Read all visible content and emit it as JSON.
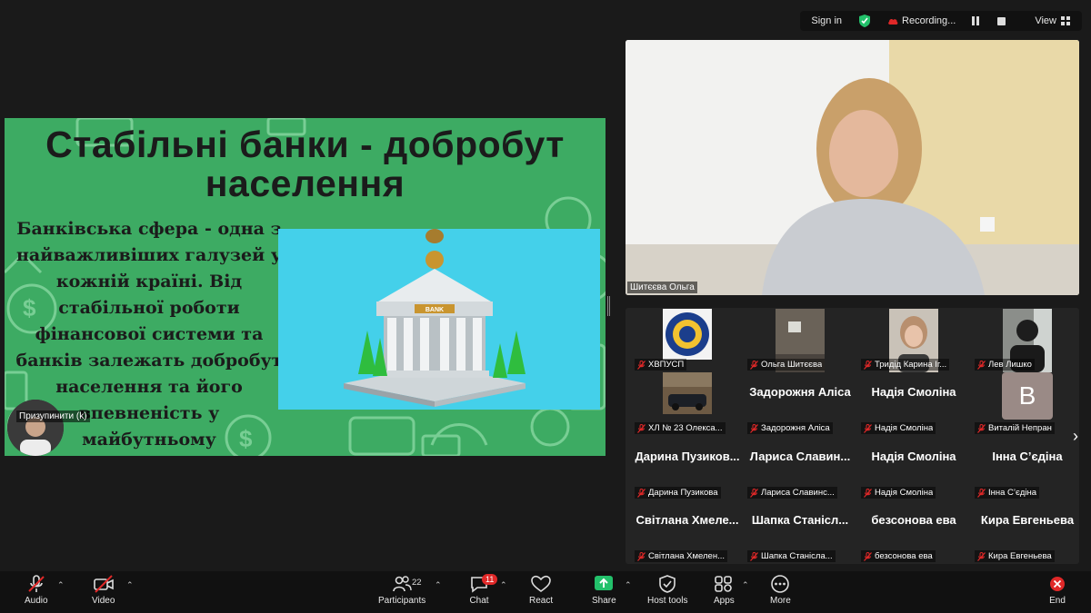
{
  "topbar": {
    "sign_in": "Sign in",
    "recording": "Recording...",
    "view": "View"
  },
  "slide": {
    "title_line1": "Стабільні банки - добробут",
    "title_line2": "населення",
    "body_lines": [
      "Банківська сфера - одна з",
      "найважливіших галузей у",
      "кожній країні. Від",
      "стабільної роботи",
      "фінансової системи та",
      "банків залежать добробут",
      "населення та його",
      "впевненість у",
      "майбутньому"
    ],
    "bank_sign": "BANK",
    "background_color": "#3dab63"
  },
  "paused_participant": {
    "label": "Призупинити (k)"
  },
  "speaker": {
    "name": "Шитєєва Ольга"
  },
  "gallery": {
    "tiles": [
      {
        "label": "ХВПУСП",
        "big": "",
        "kind": "logo"
      },
      {
        "label": "Ольга Шитєєва",
        "big": "",
        "kind": "room"
      },
      {
        "label": "Тридід Карина Іг...",
        "big": "",
        "kind": "girl"
      },
      {
        "label": "Лев Лишко",
        "big": "",
        "kind": "dark"
      },
      {
        "label": "ХЛ № 23 Олекса...",
        "big": "",
        "kind": "car"
      },
      {
        "label": "Задорожня Аліса",
        "big": "Задорожня Аліса",
        "kind": "name"
      },
      {
        "label": "Надія Смоліна",
        "big": "Надія Смоліна",
        "kind": "name"
      },
      {
        "label": "Виталій Непран",
        "big": "",
        "kind": "avatar",
        "avatar_letter": "B"
      },
      {
        "label": "Дарина Пузикова",
        "big": "Дарина Пузиков...",
        "kind": "name"
      },
      {
        "label": "Лариса Славинс...",
        "big": "Лариса Славин...",
        "kind": "name"
      },
      {
        "label": "Надія Смоліна",
        "big": "Надія Смоліна",
        "kind": "name"
      },
      {
        "label": "Інна С’єдіна",
        "big": "Інна С’єдіна",
        "kind": "name"
      },
      {
        "label": "Світлана Хмелен...",
        "big": "Світлана Хмеле...",
        "kind": "name"
      },
      {
        "label": "Шапка Станісла...",
        "big": "Шапка Станісл...",
        "kind": "name"
      },
      {
        "label": "безсонова ева",
        "big": "безсонова ева",
        "kind": "name"
      },
      {
        "label": "Кира Евгеньева",
        "big": "Кира Евгеньева",
        "kind": "name"
      }
    ]
  },
  "toolbar": {
    "audio": "Audio",
    "video": "Video",
    "participants": "Participants",
    "participants_count": "22",
    "chat": "Chat",
    "chat_badge": "11",
    "react": "React",
    "share": "Share",
    "host_tools": "Host tools",
    "apps": "Apps",
    "more": "More",
    "end": "End"
  },
  "colors": {
    "share_green": "#23c16b",
    "end_red": "#e02828",
    "mute_red": "#e02828"
  }
}
